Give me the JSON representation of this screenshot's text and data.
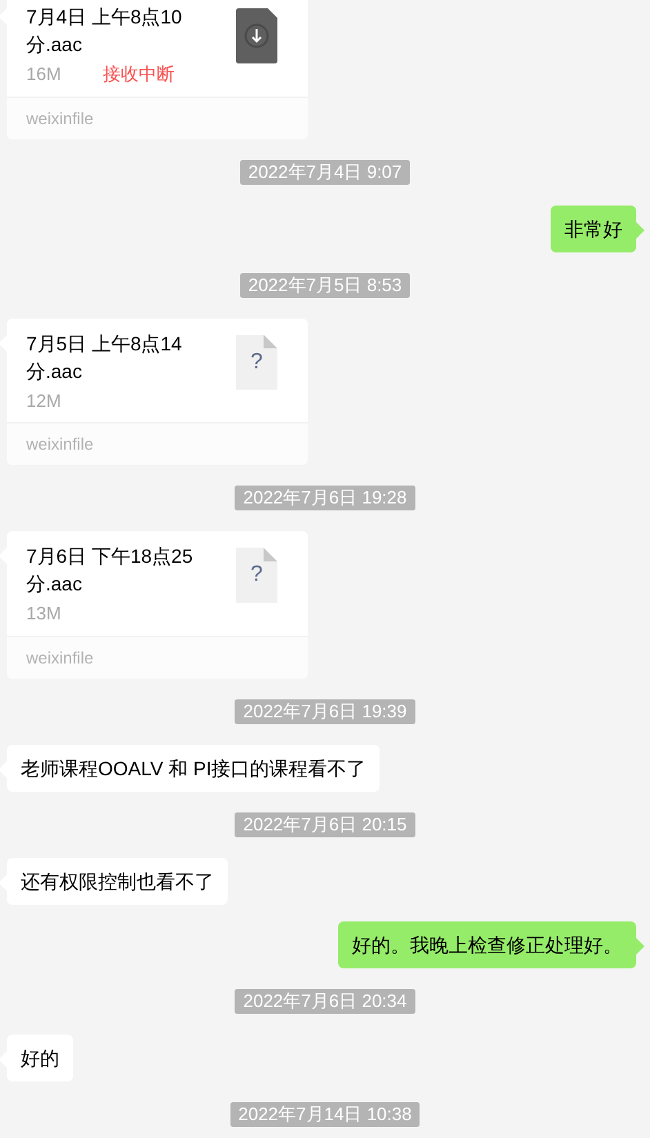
{
  "messages": [
    {
      "kind": "download_file",
      "name": "7月4日 上午8点10分.aac",
      "size": "16M",
      "status": "接收中断",
      "source": "weixinfile"
    },
    {
      "kind": "time",
      "text": "2022年7月4日 9:07"
    },
    {
      "kind": "sent",
      "text": "非常好"
    },
    {
      "kind": "time",
      "text": "2022年7月5日 8:53"
    },
    {
      "kind": "unknown_file",
      "name": "7月5日 上午8点14分.aac",
      "size": "12M",
      "glyph": "?",
      "source": "weixinfile"
    },
    {
      "kind": "time",
      "text": "2022年7月6日 19:28"
    },
    {
      "kind": "unknown_file",
      "name": "7月6日 下午18点25分.aac",
      "size": "13M",
      "glyph": "?",
      "source": "weixinfile"
    },
    {
      "kind": "time",
      "text": "2022年7月6日 19:39"
    },
    {
      "kind": "received",
      "text": "老师课程OOALV 和 PI接口的课程看不了"
    },
    {
      "kind": "time",
      "text": "2022年7月6日 20:15"
    },
    {
      "kind": "received",
      "text": "还有权限控制也看不了"
    },
    {
      "kind": "sent",
      "text": "好的。我晚上检查修正处理好。"
    },
    {
      "kind": "time",
      "text": "2022年7月6日 20:34"
    },
    {
      "kind": "received",
      "text": "好的"
    },
    {
      "kind": "time",
      "text": "2022年7月14日 10:38"
    }
  ]
}
